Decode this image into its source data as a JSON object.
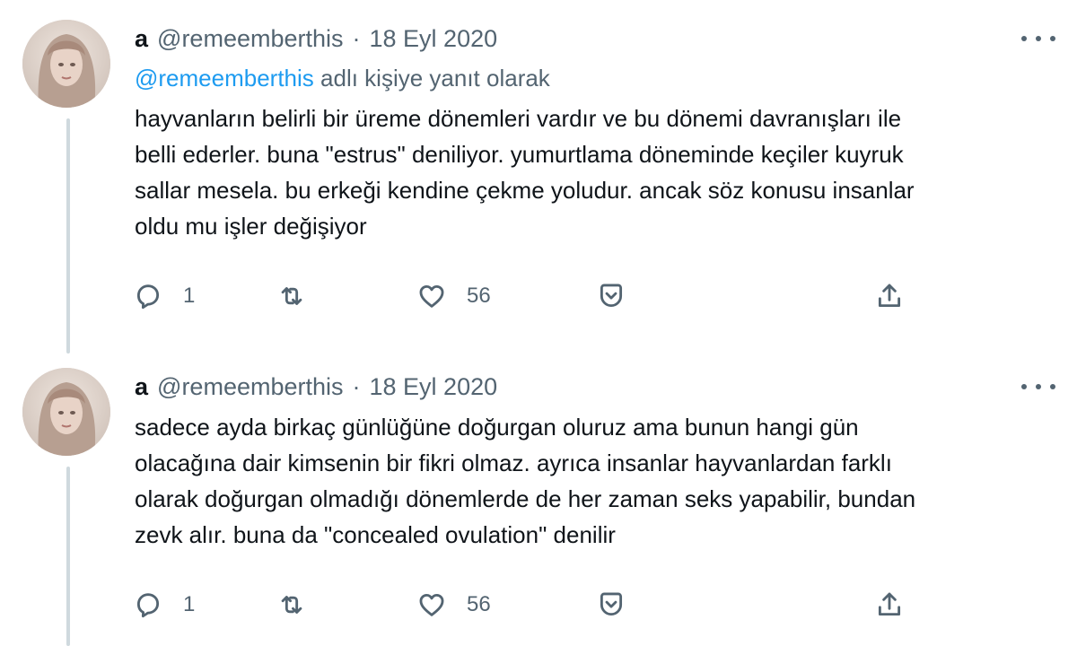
{
  "tweets": [
    {
      "name": "a",
      "handle": "@remeemberthis",
      "dot": "·",
      "date": "18 Eyl 2020",
      "reply_mention": "@remeemberthis",
      "reply_suffix": " adlı kişiye yanıt olarak",
      "lines": [
        "hayvanların belirli bir üreme dönemleri vardır ve bu dönemi davranışları ile",
        "belli ederler. buna \"estrus\" deniliyor. yumurtlama döneminde keçiler kuyruk",
        "sallar mesela. bu erkeği kendine çekme yoludur. ancak söz konusu insanlar",
        "oldu mu işler değişiyor"
      ],
      "replies": "1",
      "likes": "56"
    },
    {
      "name": "a",
      "handle": "@remeemberthis",
      "dot": "·",
      "date": "18 Eyl 2020",
      "lines": [
        "sadece ayda birkaç günlüğüne doğurgan oluruz ama bunun hangi gün",
        "olacağına dair kimsenin bir fikri olmaz. ayrıca insanlar hayvanlardan farklı",
        "olarak doğurgan olmadığı dönemlerde de her zaman seks yapabilir, bundan",
        "zevk alır. buna da \"concealed ovulation\" denilir"
      ],
      "replies": "1",
      "likes": "56"
    }
  ],
  "icons": {
    "reply": "reply-icon",
    "retweet": "retweet-icon",
    "like": "heart-icon",
    "save": "bookmark-icon",
    "share": "share-icon",
    "more": "more-options-icon"
  },
  "colors": {
    "text": "#0f1419",
    "secondary": "#536471",
    "link": "#1d9bf0",
    "thread_line": "#cfd9de"
  }
}
